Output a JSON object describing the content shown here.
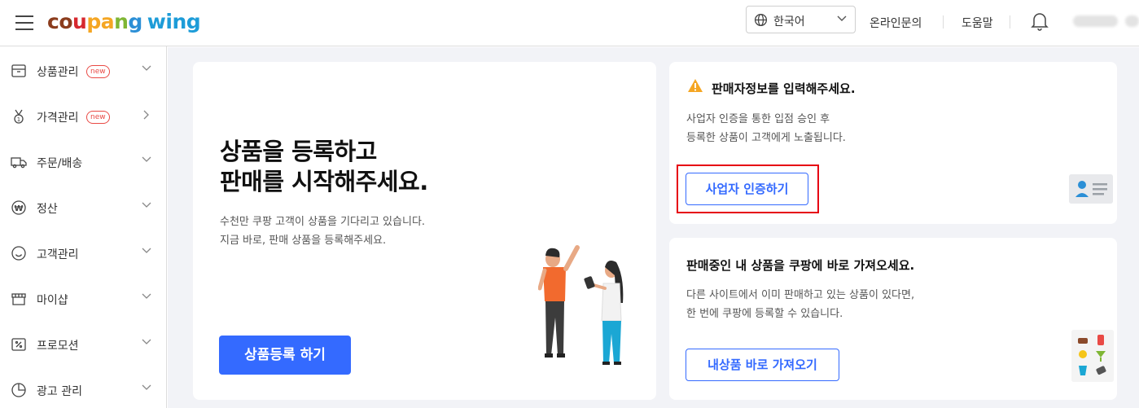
{
  "header": {
    "logo": {
      "part1": "co",
      "part2": "u",
      "part3": "pa",
      "part4": "n",
      "part5": "g",
      "wing": "wing"
    },
    "language": "한국어",
    "links": {
      "inquiry": "온라인문의",
      "help": "도움말"
    }
  },
  "sidebar": {
    "items": [
      {
        "label": "상품관리",
        "badge": "new"
      },
      {
        "label": "가격관리",
        "badge": "new"
      },
      {
        "label": "주문/배송"
      },
      {
        "label": "정산"
      },
      {
        "label": "고객관리"
      },
      {
        "label": "마이샵"
      },
      {
        "label": "프로모션"
      },
      {
        "label": "광고 관리"
      }
    ]
  },
  "hero": {
    "title_line1": "상품을 등록하고",
    "title_line2": "판매를 시작해주세요.",
    "sub_line1": "수천만 쿠팡 고객이 상품을 기다리고 있습니다.",
    "sub_line2": "지금 바로, 판매 상품을 등록해주세요.",
    "button": "상품등록 하기"
  },
  "seller_card": {
    "title": "판매자정보를 입력해주세요.",
    "desc_line1": "사업자 인증을 통한 입점 승인 후",
    "desc_line2": "등록한 상품이 고객에게 노출됩니다.",
    "button": "사업자 인증하기"
  },
  "import_card": {
    "title": "판매중인 내 상품을 쿠팡에 바로 가져오세요.",
    "desc_line1": "다른 사이트에서 이미 판매하고 있는 상품이 있다면,",
    "desc_line2": "한 번에 쿠팡에 등록할 수 있습니다.",
    "button": "내상품 바로 가져오기"
  },
  "colors": {
    "primary": "#346aff",
    "highlight": "#e60012",
    "warning": "#f5a623",
    "background": "#f2f3f7"
  }
}
